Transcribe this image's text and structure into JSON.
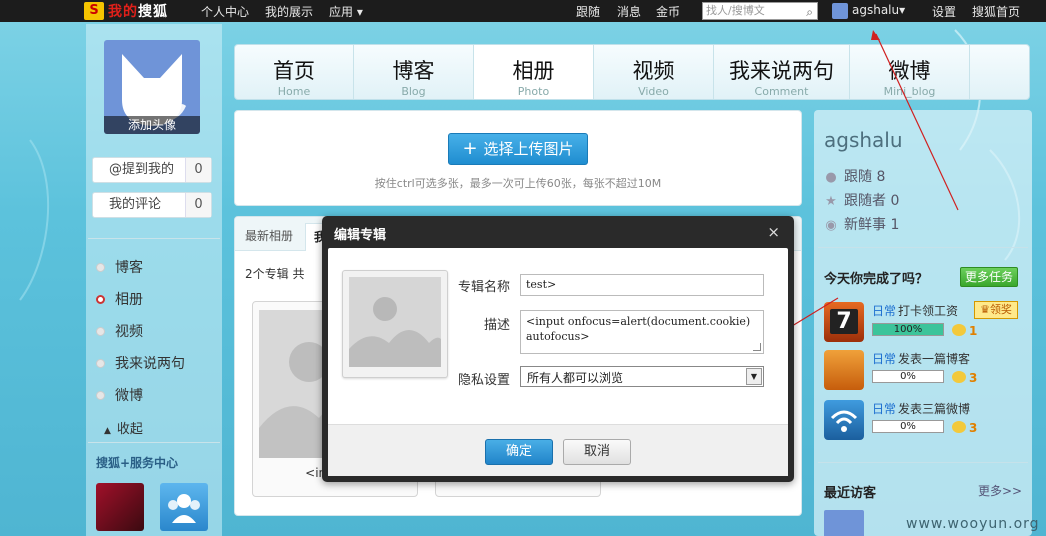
{
  "topbar": {
    "logo_mark": "S",
    "logo_text_red": "我的",
    "logo_text_white": "搜狐",
    "nav_left": [
      "个人中心",
      "我的展示",
      "应用"
    ],
    "nav_right": [
      "跟随",
      "消息",
      "金币"
    ],
    "search_placeholder": "找人/搜博文",
    "username": "agshalu",
    "links": [
      "设置",
      "搜狐首页"
    ]
  },
  "left": {
    "avatar_caption": "添加头像",
    "boxes": [
      {
        "label": "@提到我的",
        "count": "0"
      },
      {
        "label": "我的评论",
        "count": "0"
      }
    ],
    "nav": [
      "博客",
      "相册",
      "视频",
      "我来说两句",
      "微博"
    ],
    "active_nav": 1,
    "collapse": "收起",
    "service_title": "搜狐+服务中心"
  },
  "tabs": [
    {
      "cn": "首页",
      "en": "Home"
    },
    {
      "cn": "博客",
      "en": "Blog"
    },
    {
      "cn": "相册",
      "en": "Photo"
    },
    {
      "cn": "视频",
      "en": "Video"
    },
    {
      "cn": "我来说两句",
      "en": "Comment"
    },
    {
      "cn": "微博",
      "en": "Mini_blog"
    }
  ],
  "upload": {
    "button": "选择上传图片",
    "hint": "按住ctrl可选多张，最多一次可上传60张，每张不超过10M"
  },
  "album": {
    "tabs": [
      "最新相册",
      "我的"
    ],
    "count_text": "2个专辑  共",
    "card_name": "<input on"
  },
  "right": {
    "username": "agshalu",
    "stats": [
      {
        "icon": "person-icon",
        "label": "跟随",
        "value": "8"
      },
      {
        "icon": "star-icon",
        "label": "跟随者",
        "value": "0"
      },
      {
        "icon": "bubble-icon",
        "label": "新鲜事",
        "value": "1"
      }
    ],
    "tasks_title": "今天你完成了吗？",
    "more_tasks": "更多任务",
    "tasks": [
      {
        "tag": "日常",
        "label": "打卡领工资",
        "progress": 100,
        "pct": "100%",
        "coins": "1",
        "icon_text": "7"
      },
      {
        "tag": "日常",
        "label": "发表一篇博客",
        "progress": 0,
        "pct": "0%",
        "coins": "3",
        "icon_text": ""
      },
      {
        "tag": "日常",
        "label": "发表三篇微博",
        "progress": 0,
        "pct": "0%",
        "coins": "3",
        "icon_text": ""
      }
    ],
    "claim": "领奖",
    "visitors_title": "最近访客",
    "visitors_more": "更多>>"
  },
  "modal": {
    "title": "编辑专辑",
    "close": "×",
    "name_label": "专辑名称",
    "name_value": "test>",
    "desc_label": "描述",
    "desc_value": "<input onfocus=alert(document.cookie) autofocus>",
    "privacy_label": "隐私设置",
    "privacy_value": "所有人都可以浏览",
    "ok": "确定",
    "cancel": "取消"
  },
  "watermark": "www.wooyun.org"
}
